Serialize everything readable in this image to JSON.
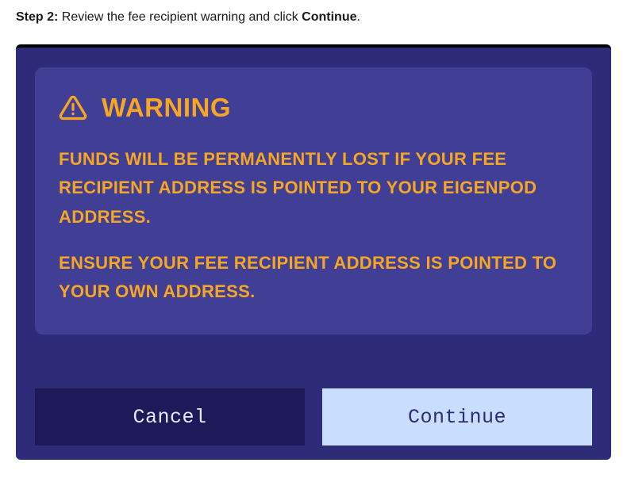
{
  "instruction": {
    "step_label": "Step 2:",
    "text_before": " Review the fee recipient warning and click ",
    "bold_word": "Continue",
    "text_after": "."
  },
  "warning": {
    "title": "WARNING",
    "paragraph1": "FUNDS WILL BE PERMANENTLY LOST IF YOUR FEE RECIPIENT ADDRESS IS POINTED TO YOUR EIGENPOD ADDRESS.",
    "paragraph2": "ENSURE YOUR FEE RECIPIENT ADDRESS IS POINTED TO YOUR OWN ADDRESS."
  },
  "buttons": {
    "cancel": "Cancel",
    "continue": "Continue"
  }
}
